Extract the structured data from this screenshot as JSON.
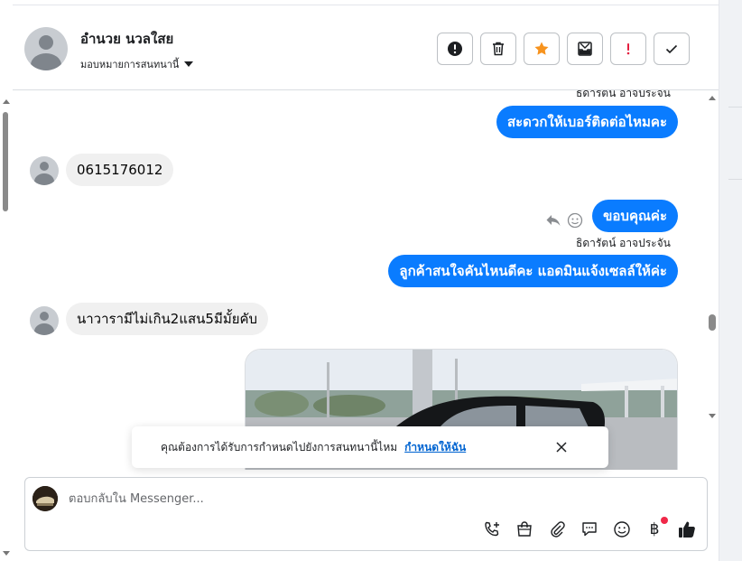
{
  "header": {
    "contact_name": "อำนวย นวลใสย",
    "assign_label": "มอบหมายการสนทนานี้",
    "actions": [
      {
        "name": "report-spam",
        "icon": "exclamation-circle-icon"
      },
      {
        "name": "delete",
        "icon": "trash-icon"
      },
      {
        "name": "star",
        "icon": "star-icon"
      },
      {
        "name": "move-to-inbox",
        "icon": "inbox-icon"
      },
      {
        "name": "mark-important",
        "icon": "exclamation-icon"
      },
      {
        "name": "mark-done",
        "icon": "check-icon"
      }
    ]
  },
  "messages": {
    "m1_sender": "ธิดารัตน์ อาจประจัน",
    "m1_text": "สะดวกให้เบอร์ติดต่อไหมคะ",
    "m2_text": "0615176012",
    "m3_text": "ขอบคุณค่ะ",
    "m4_sender": "ธิดารัตน์ อาจประจัน",
    "m4_text": "ลูกค้าสนใจคันไหนดีคะ แอดมินแจ้งเซลล์ให้ค่ะ",
    "m5_text": "นาวารามีไม่เกิน2แสน5มีมั้ยคับ"
  },
  "toast": {
    "text": "คุณต้องการได้รับการกำหนดไปยังการสนทนานี้ไหม",
    "link": "กำหนดให้ฉัน"
  },
  "composer": {
    "placeholder": "ตอบกลับใน Messenger..."
  },
  "colors": {
    "outgoing_bubble": "#0a7cff",
    "incoming_bubble": "#f0f0f0",
    "star": "#f7931e",
    "important": "#e41e3f",
    "link": "#0064d1"
  }
}
